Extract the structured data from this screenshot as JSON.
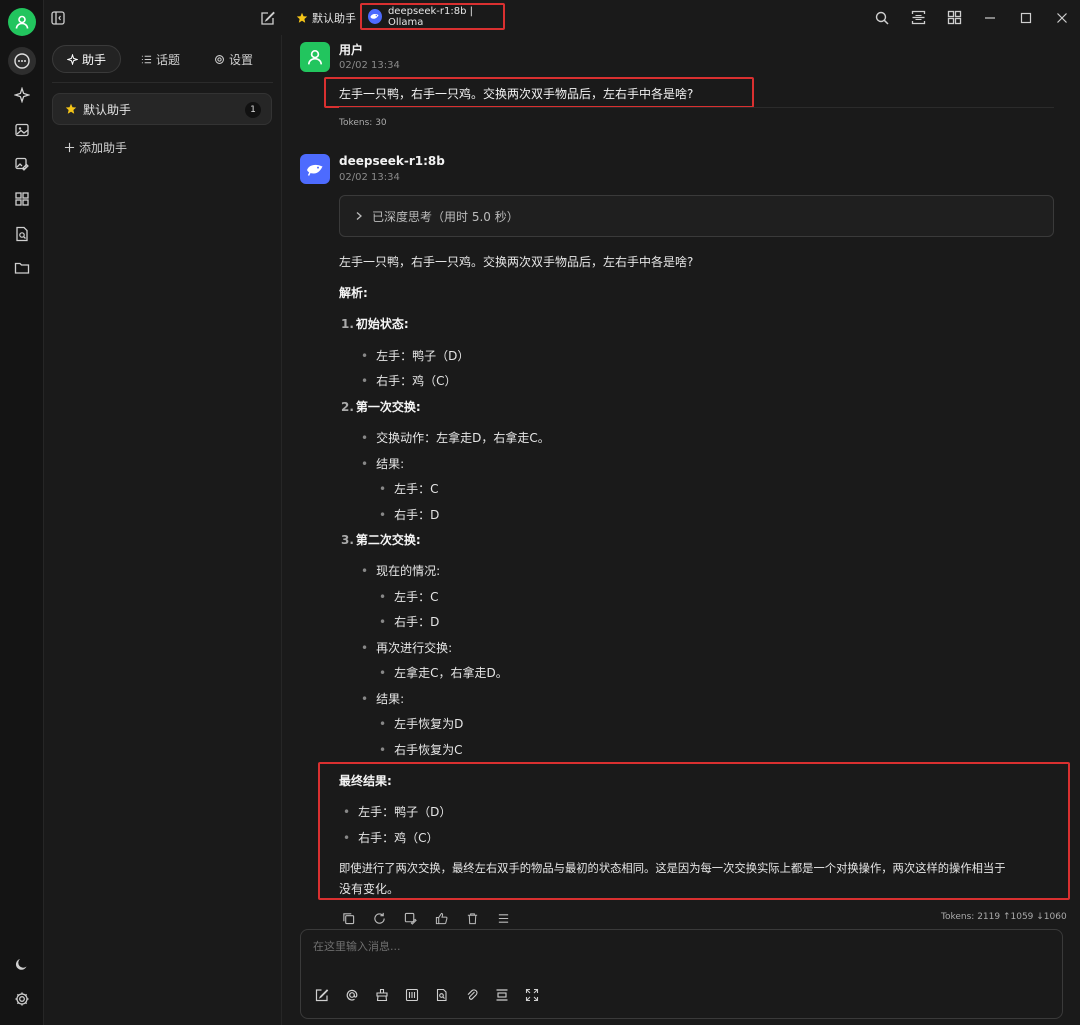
{
  "topbar": {
    "assistant_name": "默认助手",
    "model_label": "deepseek-r1:8b | Ollama"
  },
  "sidebar": {
    "tabs": [
      {
        "label": "助手",
        "icon": "sparkle-icon"
      },
      {
        "label": "话题",
        "icon": "list-icon"
      },
      {
        "label": "设置",
        "icon": "gear-icon"
      }
    ],
    "assistant": {
      "name": "默认助手",
      "count": "1"
    },
    "add_assistant": "添加助手"
  },
  "chat": {
    "user_message": {
      "name": "用户",
      "time": "02/02 13:34",
      "text": "左手一只鸭，右手一只鸡。交换两次双手物品后，左右手中各是啥?",
      "tokens": "Tokens: 30"
    },
    "assistant_message": {
      "name": "deepseek-r1:8b",
      "time": "02/02 13:34",
      "thinking": "已深度思考（用时 5.0 秒）",
      "question": "左手一只鸭，右手一只鸡。交换两次双手物品后，左右手中各是啥?",
      "analysis_title": "解析:",
      "s1_num": "1.",
      "s1_title": "初始状态:",
      "s1_b1": "左手：鸭子（D）",
      "s1_b2": "右手：鸡（C）",
      "s2_num": "2.",
      "s2_title": "第一次交换:",
      "s2_b1": "交换动作：左拿走D，右拿走C。",
      "s2_b2": "结果:",
      "s2_b2a": "左手：C",
      "s2_b2b": "右手：D",
      "s3_num": "3.",
      "s3_title": "第二次交换:",
      "s3_b1": "现在的情况:",
      "s3_b1a": "左手：C",
      "s3_b1b": "右手：D",
      "s3_b2": "再次进行交换:",
      "s3_b2a": "左拿走C，右拿走D。",
      "s3_b3": "结果:",
      "s3_b3a": "左手恢复为D",
      "s3_b3b": "右手恢复为C",
      "final_title": "最终结果:",
      "final_b1": "左手：鸭子（D）",
      "final_b2": "右手：鸡（C）",
      "conclusion_1": "即使进行了两次交换，最终左右双手的物品与最初的状态相同。这是因为每一次交换实际上都是一个对换操作，两次这样的操作相当于",
      "conclusion_2": "没有变化。",
      "tokens": "Tokens: 2119 ↑1059 ↓1060"
    }
  },
  "composer": {
    "placeholder": "在这里输入消息..."
  },
  "colors": {
    "highlight": "#d93030",
    "user_avatar": "#22c55e",
    "deepseek": "#4d6bfe",
    "star": "#f5c518"
  }
}
